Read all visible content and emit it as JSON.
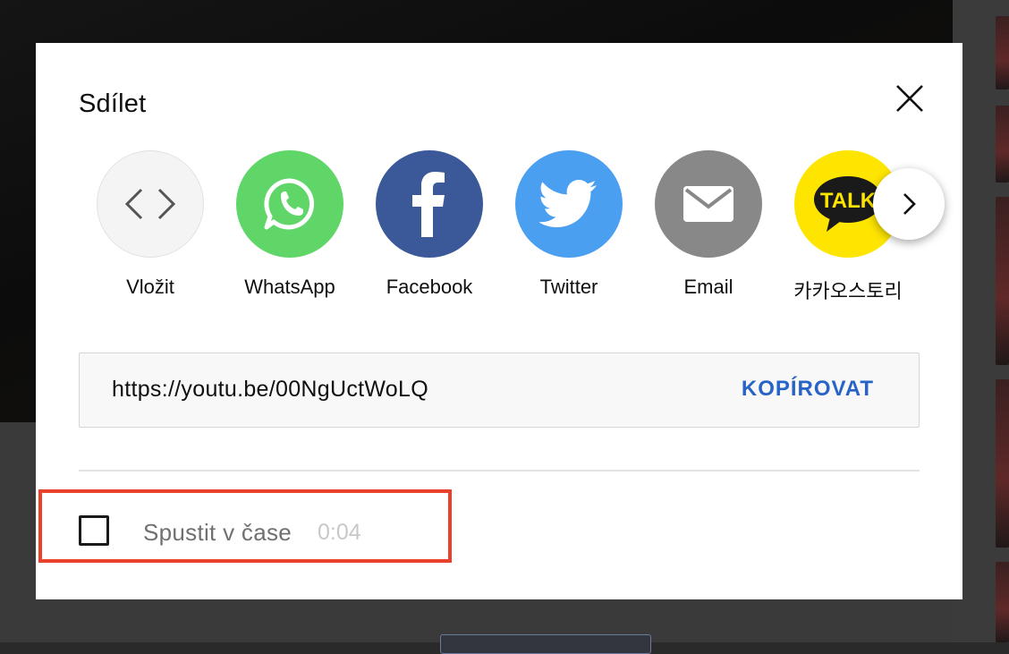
{
  "dialog": {
    "title": "Sdílet",
    "close_icon": "close-icon"
  },
  "share_targets": [
    {
      "label": "Vložit",
      "icon": "embed-code-icon",
      "color": "#f4f4f4"
    },
    {
      "label": "WhatsApp",
      "icon": "whatsapp-icon",
      "color": "#60d669"
    },
    {
      "label": "Facebook",
      "icon": "facebook-icon",
      "color": "#3b5998"
    },
    {
      "label": "Twitter",
      "icon": "twitter-icon",
      "color": "#4a9ff0"
    },
    {
      "label": "Email",
      "icon": "email-icon",
      "color": "#888888"
    },
    {
      "label": "카카오스토리",
      "icon": "kakaotalk-icon",
      "color": "#fee500",
      "badge_text": "TALK"
    }
  ],
  "next_icon": "chevron-right-icon",
  "link": {
    "url": "https://youtu.be/00NgUctWoLQ",
    "copy_label": "KOPÍROVAT",
    "copy_color": "#2863c8"
  },
  "start_at": {
    "label": "Spustit v čase",
    "time": "0:04",
    "checked": false
  },
  "highlight_color": "#e8412c"
}
